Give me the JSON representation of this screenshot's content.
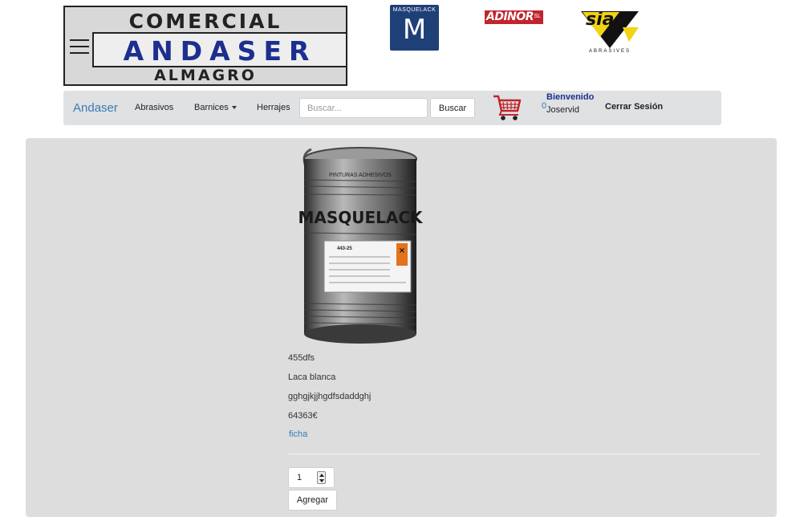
{
  "header": {
    "logo_andaser": {
      "top": "COMERCIAL",
      "middle": "ANDASER",
      "bottom": "ALMAGRO"
    },
    "logo_masquelack": {
      "brand": "MASQUELACK",
      "mark": "M"
    },
    "logo_adinor": {
      "name": "ADINOR",
      "suffix": "SL"
    },
    "logo_sia": {
      "name": "sia",
      "subtitle": "ABRASIVES"
    }
  },
  "navbar": {
    "brand": "Andaser",
    "items": [
      {
        "label": "Abrasivos"
      },
      {
        "label": "Barnices"
      },
      {
        "label": "Herrajes"
      }
    ],
    "search": {
      "placeholder": "Buscar...",
      "value": "",
      "button_label": "Buscar"
    },
    "cart": {
      "icon": "shopping-cart-icon",
      "count": "0"
    },
    "user": {
      "welcome": "Bienvenido",
      "name": "Joservid"
    },
    "logout_label": "Cerrar Sesión"
  },
  "product": {
    "code": "455dfs",
    "name": "Laca blanca",
    "description": "gghgjkjjhgdfsdaddghj",
    "price": "64363€",
    "link_label": "ficha",
    "image_text": {
      "brand": "MASQUELACK",
      "top_band": "PINTURAS ADHESIVOS",
      "label_code": "443-25"
    },
    "quantity": "1",
    "add_label": "Agregar"
  },
  "colors": {
    "navbar_bg": "#dfe1e2",
    "main_bg": "#dcdddc",
    "link": "#3a7ab8",
    "welcome": "#1c2f8f",
    "adinor_red": "#c0252d",
    "masquelack_blue": "#1f3f77",
    "sia_yellow": "#f3d313"
  }
}
